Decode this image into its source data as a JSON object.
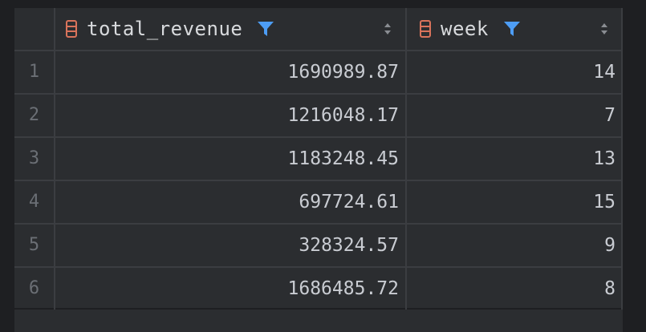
{
  "columns": [
    {
      "name": "total_revenue",
      "icon": "column-icon",
      "filter_icon": "filter-icon",
      "sort_icon": "sort-icon"
    },
    {
      "name": "week",
      "icon": "column-icon",
      "filter_icon": "filter-icon",
      "sort_icon": "sort-icon"
    }
  ],
  "rows": [
    {
      "num": "1",
      "total_revenue": "1690989.87",
      "week": "14"
    },
    {
      "num": "2",
      "total_revenue": "1216048.17",
      "week": "7"
    },
    {
      "num": "3",
      "total_revenue": "1183248.45",
      "week": "13"
    },
    {
      "num": "4",
      "total_revenue": "697724.61",
      "week": "15"
    },
    {
      "num": "5",
      "total_revenue": "328324.57",
      "week": "9"
    },
    {
      "num": "6",
      "total_revenue": "1686485.72",
      "week": "8"
    }
  ],
  "colors": {
    "background": "#1e1f22",
    "cell_background": "#2b2d30",
    "grid_line": "#3b3d41",
    "column_icon": "#d9735b",
    "filter_icon": "#4d9df5",
    "row_number": "#6b6f75"
  }
}
